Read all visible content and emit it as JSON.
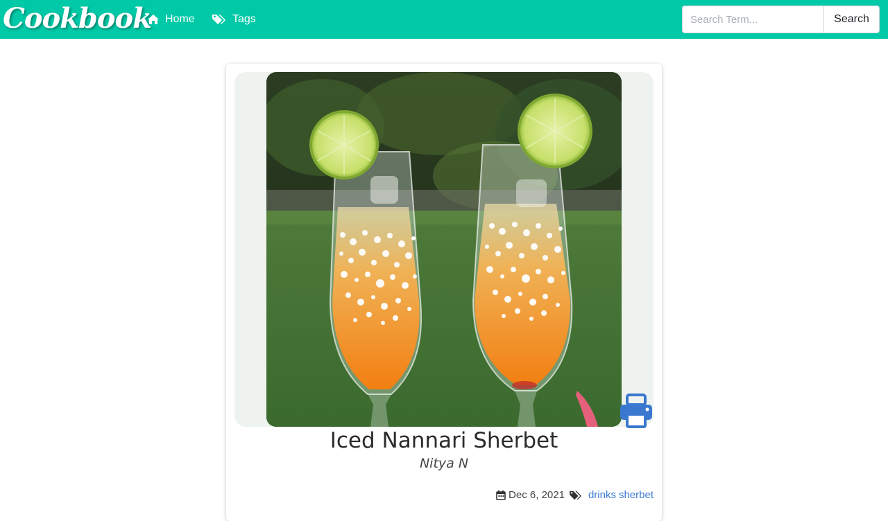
{
  "brand": {
    "name": "Cookbook"
  },
  "nav": {
    "home_label": "Home",
    "tags_label": "Tags"
  },
  "search": {
    "placeholder": "Search Term...",
    "button_label": "Search"
  },
  "recipe": {
    "title": "Iced Nannari Sherbet",
    "author": "Nitya N",
    "date": "Dec 6, 2021",
    "tags": [
      "drinks",
      "sherbet"
    ]
  },
  "icons": {
    "home": "home-icon",
    "tags": "tags-icon",
    "print": "print-icon",
    "calendar": "calendar-icon",
    "tag": "tags-icon"
  },
  "colors": {
    "navbar": "#00c9a7",
    "link": "#3a78d0",
    "print": "#3a78d0"
  }
}
